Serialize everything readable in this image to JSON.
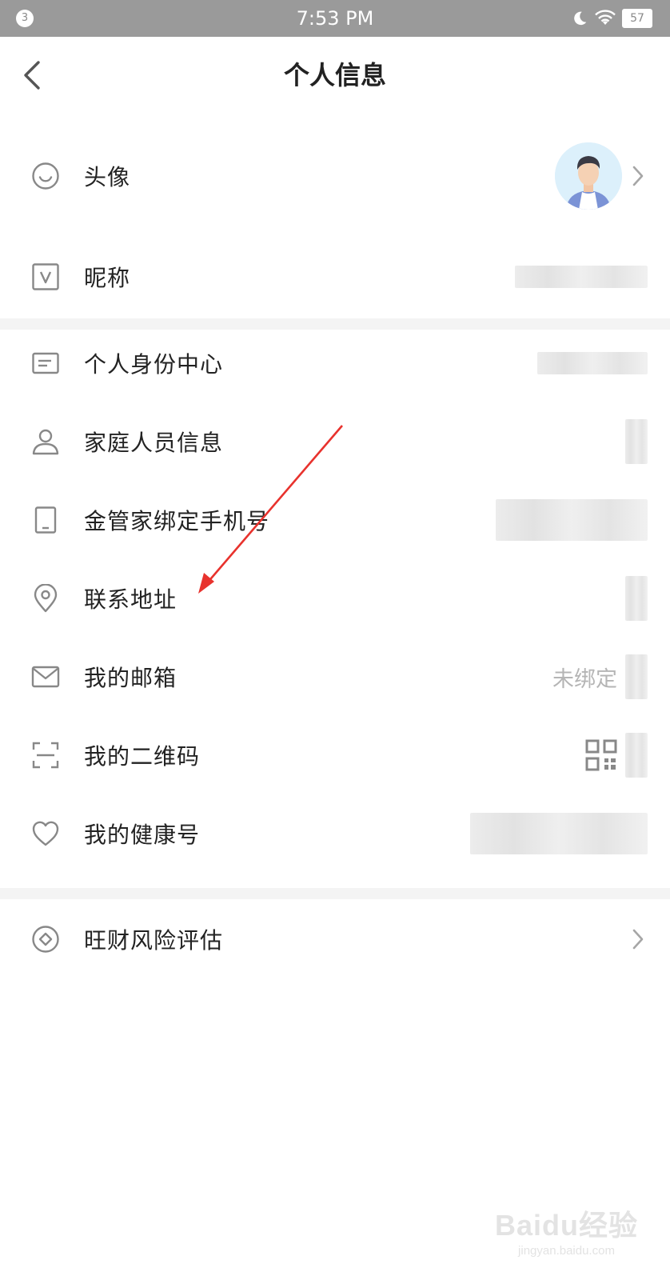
{
  "status_bar": {
    "notification_count": "3",
    "time": "7:53 PM",
    "battery": "57",
    "icons": [
      "moon-icon",
      "wifi-icon",
      "battery-icon"
    ]
  },
  "nav": {
    "title": "个人信息",
    "back_icon": "chevron-left-icon"
  },
  "rows": [
    {
      "label": "头像",
      "icon": "smile-icon",
      "right": "avatar+chevron"
    },
    {
      "label": "昵称",
      "icon": "v-badge-icon",
      "right": "blurred"
    },
    {
      "label": "个人身份中心",
      "icon": "id-card-icon",
      "right": "blurred"
    },
    {
      "label": "家庭人员信息",
      "icon": "person-icon",
      "right": "blurred"
    },
    {
      "label": "金管家绑定手机号",
      "icon": "phone-icon",
      "right": "blurred"
    },
    {
      "label": "联系地址",
      "icon": "location-pin-icon",
      "right": "blurred"
    },
    {
      "label": "我的邮箱",
      "icon": "mail-icon",
      "right_text": "未绑定"
    },
    {
      "label": "我的二维码",
      "icon": "scan-icon",
      "right": "qr-code"
    },
    {
      "label": "我的健康号",
      "icon": "heart-icon",
      "right": "blurred"
    },
    {
      "label": "旺财风险评估",
      "icon": "diamond-circle-icon",
      "right": "chevron"
    }
  ],
  "annotation": {
    "type": "red-arrow",
    "color": "#e8322d",
    "points_to": "联系地址"
  },
  "watermark": {
    "main": "Baidu经验",
    "sub": "jingyan.baidu.com"
  },
  "colors": {
    "status_bar": "#9a9a9a",
    "icon_gray": "#888888",
    "muted_text": "#b5b5b5"
  }
}
